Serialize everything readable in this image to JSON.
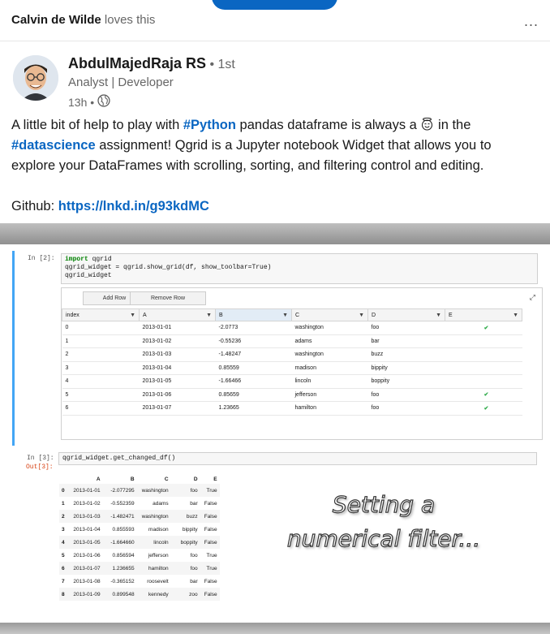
{
  "social": {
    "actor": "Calvin de Wilde",
    "action": "loves this",
    "more": "..."
  },
  "author": {
    "name": "AbdulMajedRaja RS",
    "degree": "• 1st",
    "headline": "Analyst | Developer",
    "time": "13h •"
  },
  "post": {
    "t1": "A little bit of help to play with ",
    "tag_python": "#Python",
    "t2": " pandas dataframe is always a ",
    "t3": " in the ",
    "tag_ds": "#datascience",
    "t4": " assignment! Qgrid is a Jupyter notebook Widget that allows you to explore your DataFrames with scrolling, sorting, and filtering control and editing.",
    "github_label": "Github: ",
    "github_link": "https://lnkd.in/g93kdMC"
  },
  "notebook": {
    "cell1_prompt": "In [2]:",
    "cell1_code": [
      "import qgrid",
      "qgrid_widget = qgrid.show_grid(df, show_toolbar=True)",
      "qgrid_widget"
    ],
    "add_row": "Add Row",
    "remove_row": "Remove Row",
    "grid_headers": [
      "index",
      "A",
      "B",
      "C",
      "D",
      "E"
    ],
    "grid_rows": [
      [
        "0",
        "2013-01-01",
        "-2.0773",
        "washington",
        "foo",
        true
      ],
      [
        "1",
        "2013-01-02",
        "-0.55236",
        "adams",
        "bar",
        false
      ],
      [
        "2",
        "2013-01-03",
        "-1.48247",
        "washington",
        "buzz",
        false
      ],
      [
        "3",
        "2013-01-04",
        "0.85559",
        "madison",
        "bippity",
        false
      ],
      [
        "4",
        "2013-01-05",
        "-1.66466",
        "lincoln",
        "boppity",
        false
      ],
      [
        "5",
        "2013-01-06",
        "0.85659",
        "jefferson",
        "foo",
        true
      ],
      [
        "6",
        "2013-01-07",
        "1.23665",
        "hamilton",
        "foo",
        true
      ]
    ],
    "cell2_prompt": "In [3]:",
    "cell2_code": "qgrid_widget.get_changed_df()",
    "out_prompt": "Out[3]:",
    "df_headers": [
      "",
      "A",
      "B",
      "C",
      "D",
      "E"
    ],
    "df_rows": [
      [
        "0",
        "2013-01-01",
        "-2.077295",
        "washington",
        "foo",
        "True"
      ],
      [
        "1",
        "2013-01-02",
        "-0.552359",
        "adams",
        "bar",
        "False"
      ],
      [
        "2",
        "2013-01-03",
        "-1.482471",
        "washington",
        "buzz",
        "False"
      ],
      [
        "3",
        "2013-01-04",
        "0.855593",
        "madison",
        "bippity",
        "False"
      ],
      [
        "4",
        "2013-01-05",
        "-1.664660",
        "lincoln",
        "boppity",
        "False"
      ],
      [
        "5",
        "2013-01-06",
        "0.856594",
        "jefferson",
        "foo",
        "True"
      ],
      [
        "6",
        "2013-01-07",
        "1.236655",
        "hamilton",
        "foo",
        "True"
      ],
      [
        "7",
        "2013-01-08",
        "-0.365152",
        "roosevelt",
        "bar",
        "False"
      ],
      [
        "8",
        "2013-01-09",
        "0.899548",
        "kennedy",
        "zoo",
        "False"
      ]
    ],
    "overlay": [
      "Setting a",
      "numerical filter..."
    ]
  },
  "colors": {
    "link": "#0a66c2",
    "check": "#2eab49",
    "cell_border": "#42a5f5"
  },
  "icons": {
    "globe": "globe-icon",
    "halo_emoji": "smiling-face-with-halo-icon",
    "filter": "filter-icon",
    "expand": "expand-icon",
    "more": "more-icon"
  }
}
